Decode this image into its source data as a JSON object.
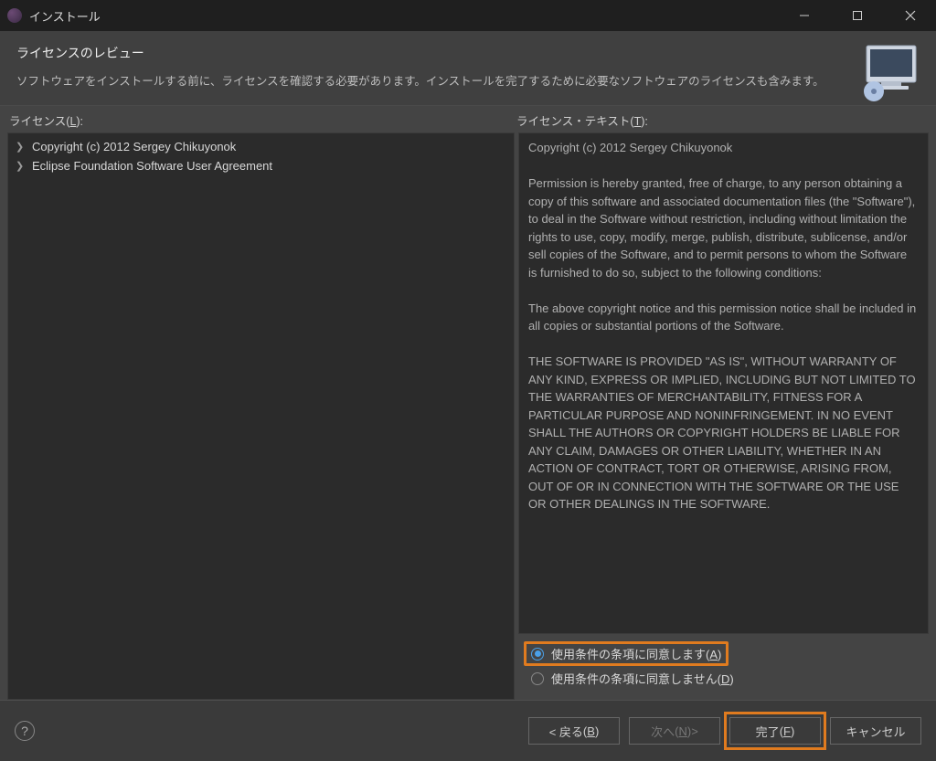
{
  "window": {
    "title": "インストール"
  },
  "banner": {
    "title": "ライセンスのレビュー",
    "description": "ソフトウェアをインストールする前に、ライセンスを確認する必要があります。インストールを完了するために必要なソフトウェアのライセンスも含みます。"
  },
  "labels": {
    "licenses": "ライセンス",
    "licenses_mnemonic": "L",
    "license_text": "ライセンス・テキスト",
    "license_text_mnemonic": "T"
  },
  "tree": {
    "items": [
      {
        "label": "Copyright (c) 2012 Sergey Chikuyonok"
      },
      {
        "label": "Eclipse Foundation Software User Agreement"
      }
    ]
  },
  "license_body": "Copyright (c) 2012 Sergey Chikuyonok\n\nPermission is hereby granted, free of charge, to any person obtaining a copy of this software and associated documentation files (the \"Software\"), to deal in the Software without restriction, including without limitation the rights to use, copy, modify, merge, publish, distribute, sublicense, and/or sell copies of the Software, and to permit persons to whom the Software is furnished to do so, subject to the following conditions:\n\nThe above copyright notice and this permission notice shall be included in all copies or substantial portions of the Software.\n\nTHE SOFTWARE IS PROVIDED \"AS IS\", WITHOUT WARRANTY OF ANY KIND, EXPRESS OR IMPLIED, INCLUDING BUT NOT LIMITED TO THE WARRANTIES OF MERCHANTABILITY, FITNESS FOR A PARTICULAR PURPOSE AND NONINFRINGEMENT. IN NO EVENT SHALL THE AUTHORS OR COPYRIGHT HOLDERS BE LIABLE FOR ANY CLAIM, DAMAGES OR OTHER LIABILITY, WHETHER IN AN ACTION OF CONTRACT, TORT OR OTHERWISE, ARISING FROM, OUT OF OR IN CONNECTION WITH THE SOFTWARE OR THE USE OR OTHER DEALINGS IN THE SOFTWARE.",
  "agreement": {
    "accept_label": "使用条件の条項に同意します",
    "accept_mnemonic": "A",
    "decline_label": "使用条件の条項に同意しません",
    "decline_mnemonic": "D",
    "selected": "accept"
  },
  "buttons": {
    "back": "< 戻る",
    "back_mnemonic": "B",
    "next": "次へ",
    "next_mnemonic": "N",
    "next_suffix": " >",
    "finish": "完了",
    "finish_mnemonic": "F",
    "cancel": "キャンセル"
  }
}
